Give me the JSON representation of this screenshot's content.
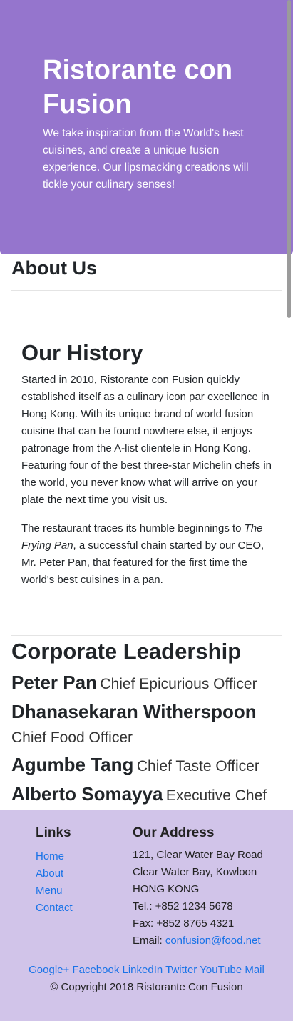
{
  "jumbotron": {
    "title": "Ristorante con Fusion",
    "text": "We take inspiration from the World's best cuisines, and create a unique fusion experience. Our lipsmacking creations will tickle your culinary senses!"
  },
  "about": {
    "heading": "About Us",
    "history_heading": "Our History",
    "paragraph1": "Started in 2010, Ristorante con Fusion quickly established itself as a culinary icon par excellence in Hong Kong. With its unique brand of world fusion cuisine that can be found nowhere else, it enjoys patronage from the A-list clientele in Hong Kong. Featuring four of the best three-star Michelin chefs in the world, you never know what will arrive on your plate the next time you visit us.",
    "paragraph2_prefix": "The restaurant traces its humble beginnings to ",
    "paragraph2_em": "The Frying Pan",
    "paragraph2_suffix": ", a successful chain started by our CEO, Mr. Peter Pan, that featured for the first time the world's best cuisines in a pan."
  },
  "leadership": {
    "heading": "Corporate Leadership",
    "leaders": [
      {
        "name": "Peter Pan",
        "title": "Chief Epicurious Officer"
      },
      {
        "name": "Dhanasekaran Witherspoon",
        "title": "Chief Food Officer"
      },
      {
        "name": "Agumbe Tang",
        "title": "Chief Taste Officer"
      },
      {
        "name": "Alberto Somayya",
        "title": "Executive Chef"
      }
    ]
  },
  "footer": {
    "links_heading": "Links",
    "links": [
      "Home",
      "About",
      "Menu",
      "Contact"
    ],
    "address_heading": "Our Address",
    "address_lines": [
      "121, Clear Water Bay Road",
      "Clear Water Bay, Kowloon",
      "HONG KONG"
    ],
    "tel": "Tel.: +852 1234 5678",
    "fax": "Fax: +852 8765 4321",
    "email_label": "Email: ",
    "email": "confusion@food.net",
    "social": [
      "Google+",
      "Facebook",
      "LinkedIn",
      "Twitter",
      "YouTube",
      "Mail"
    ],
    "copyright": "© Copyright 2018 Ristorante Con Fusion"
  },
  "colors": {
    "jumbotron_bg": "#9575cd",
    "footer_bg": "#d1c4e9",
    "link": "#1a73e8"
  }
}
